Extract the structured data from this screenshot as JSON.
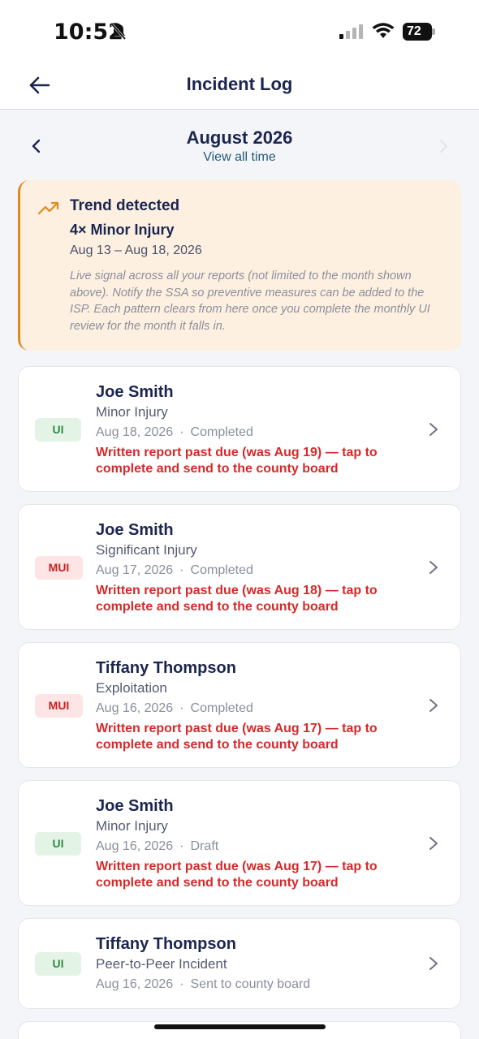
{
  "status_bar": {
    "time": "10:52",
    "battery": "72",
    "icons": [
      "bell-off-icon",
      "signal-icon",
      "wifi-icon",
      "battery-icon"
    ]
  },
  "nav": {
    "title": "Incident Log",
    "back_icon": "arrow-left-icon"
  },
  "month": {
    "title": "August 2026",
    "view_all": "View all time"
  },
  "trend": {
    "title": "Trend detected",
    "subtitle": "4× Minor Injury",
    "dates": "Aug 13 – Aug 18, 2026",
    "note": "Live signal across all your reports (not limited to the month shown above). Notify the SSA so preventive measures can be added to the ISP. Each pattern clears from here once you complete the monthly UI review for the month it falls in.",
    "accent": "#e08a1e"
  },
  "incidents": [
    {
      "badge": "UI",
      "name": "Joe Smith",
      "type": "Minor Injury",
      "date": "Aug 18, 2026",
      "sep": "·",
      "status": "Completed",
      "warning": "Written report past due (was Aug 19) — tap to complete and send to the county board"
    },
    {
      "badge": "MUI",
      "name": "Joe Smith",
      "type": "Significant Injury",
      "date": "Aug 17, 2026",
      "sep": "·",
      "status": "Completed",
      "warning": "Written report past due (was Aug 18) — tap to complete and send to the county board"
    },
    {
      "badge": "MUI",
      "name": "Tiffany Thompson",
      "type": "Exploitation",
      "date": "Aug 16, 2026",
      "sep": "·",
      "status": "Completed",
      "warning": "Written report past due (was Aug 17) — tap to complete and send to the county board"
    },
    {
      "badge": "UI",
      "name": "Joe Smith",
      "type": "Minor Injury",
      "date": "Aug 16, 2026",
      "sep": "·",
      "status": "Draft",
      "warning": "Written report past due (was Aug 17) — tap to complete and send to the county board"
    },
    {
      "badge": "UI",
      "name": "Tiffany Thompson",
      "type": "Peer-to-Peer Incident",
      "date": "Aug 16, 2026",
      "sep": "·",
      "status": "Sent to county board",
      "warning": ""
    }
  ],
  "colors": {
    "primary": "#1b2550",
    "danger": "#d42a2a",
    "ui_badge_bg": "#e3f4e6",
    "ui_badge_fg": "#2e8b43",
    "mui_badge_bg": "#fde5e5",
    "mui_badge_fg": "#c62424",
    "trend_bg": "#fdf0e1"
  }
}
